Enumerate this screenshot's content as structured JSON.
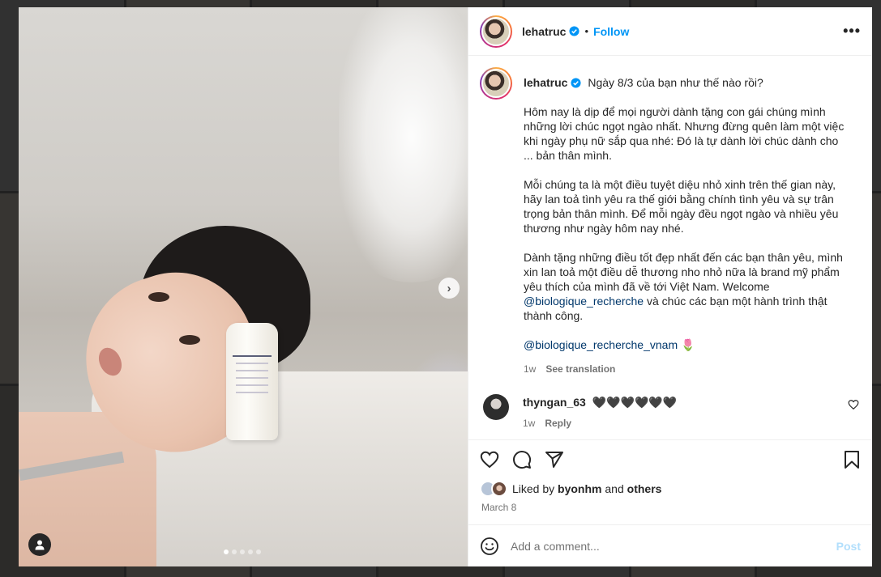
{
  "post": {
    "username": "lehatruc",
    "follow_label": "Follow",
    "separator": "•",
    "more_label": "•••"
  },
  "caption": {
    "first_line": "Ngày 8/3 của bạn như thế nào rồi?",
    "paragraph_1": "Hôm nay là dịp để mọi người dành tặng con gái chúng mình những lời chúc ngọt ngào nhất. Nhưng đừng quên làm một việc khi ngày phụ nữ sắp qua nhé: Đó là tự dành lời chúc dành cho ... bản thân mình.",
    "paragraph_2": "Mỗi chúng ta là một điều tuyệt diệu nhỏ xinh trên thế gian này, hãy lan toả tình yêu ra thế giới bằng chính tình yêu và sự trân trọng bản thân mình. Để mỗi ngày đều ngọt ngào và nhiều yêu thương như ngày hôm nay nhé.",
    "paragraph_3_text": "Dành tặng những điều tốt đẹp nhất đến các bạn thân yêu, mình xin lan toả một điều dễ thương nho nhỏ nữa là brand mỹ phẩm yêu thích của mình đã về tới Việt Nam. Welcome",
    "paragraph_3_mention": "@biologique_recherche",
    "paragraph_3_tail": " và chúc các bạn một hành trình thật thành công.",
    "final_mention": "@biologique_recherche_vnam",
    "final_emoji": "🌷",
    "time": "1w",
    "see_translation": "See translation"
  },
  "comments": [
    {
      "username": "thyngan_63",
      "text": "🖤🖤🖤🖤🖤🖤",
      "time": "1w",
      "reply_label": "Reply"
    }
  ],
  "likes": {
    "prefix": "Liked by",
    "user": "byonhm",
    "connector": "and",
    "others": "others"
  },
  "date": "March 8",
  "composer": {
    "placeholder": "Add a comment...",
    "post_label": "Post"
  },
  "carousel": {
    "slide_count": 5,
    "active_index": 0
  },
  "colors": {
    "accent": "#0095f6",
    "post_disabled": "#b2dffc",
    "verified": "#0095f6"
  }
}
